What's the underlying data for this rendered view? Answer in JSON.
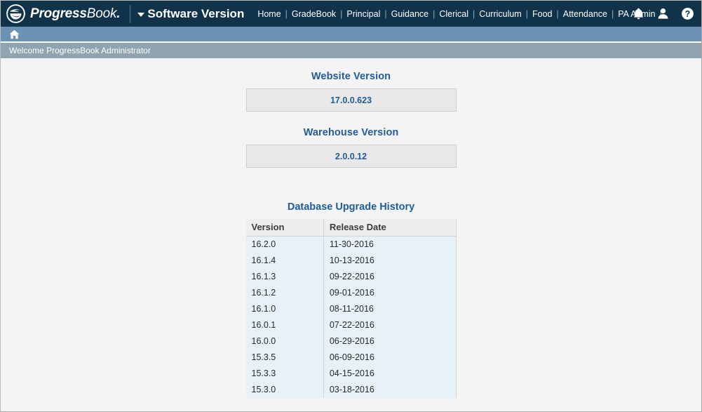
{
  "header": {
    "brand_bold": "Progress",
    "brand_light": "Book",
    "brand_dot": ".",
    "brand_logo_icon": "progressbook-logo-icon",
    "module_title": "Software Version",
    "module_caret_icon": "caret-down-icon",
    "menu": [
      {
        "label": "Home"
      },
      {
        "label": "GradeBook"
      },
      {
        "label": "Principal"
      },
      {
        "label": "Guidance"
      },
      {
        "label": "Clerical"
      },
      {
        "label": "Curriculum"
      },
      {
        "label": "Food"
      },
      {
        "label": "Attendance"
      },
      {
        "label": "PA Admin"
      }
    ],
    "separator": "|",
    "icons": {
      "notifications": "bell-icon",
      "user": "user-icon",
      "help": "help-icon"
    },
    "background_color": "#113349"
  },
  "subnav": {
    "home_icon": "home-icon",
    "background_color": "#6b91b3"
  },
  "welcome": {
    "text": "Welcome ProgressBook Administrator",
    "background_color": "#8fa3b0"
  },
  "main": {
    "website_version": {
      "title": "Website Version",
      "value": "17.0.0.623"
    },
    "warehouse_version": {
      "title": "Warehouse Version",
      "value": "2.0.0.12"
    },
    "history": {
      "title": "Database Upgrade History",
      "columns": [
        "Version",
        "Release Date"
      ],
      "rows": [
        [
          "16.2.0",
          "11-30-2016"
        ],
        [
          "16.1.4",
          "10-13-2016"
        ],
        [
          "16.1.3",
          "09-22-2016"
        ],
        [
          "16.1.2",
          "09-01-2016"
        ],
        [
          "16.1.0",
          "08-11-2016"
        ],
        [
          "16.0.1",
          "07-22-2016"
        ],
        [
          "16.0.0",
          "06-29-2016"
        ],
        [
          "15.3.5",
          "06-09-2016"
        ],
        [
          "15.3.3",
          "04-15-2016"
        ],
        [
          "15.3.0",
          "03-18-2016"
        ]
      ]
    }
  },
  "colors": {
    "accent_blue": "#1f5c99",
    "nav_dark": "#113349",
    "subnav_blue": "#6b91b3",
    "welcome_gray": "#8fa3b0",
    "table_row": "#e6f1f8",
    "table_header": "#eeeeee",
    "page_bg": "#f4f4f4"
  }
}
